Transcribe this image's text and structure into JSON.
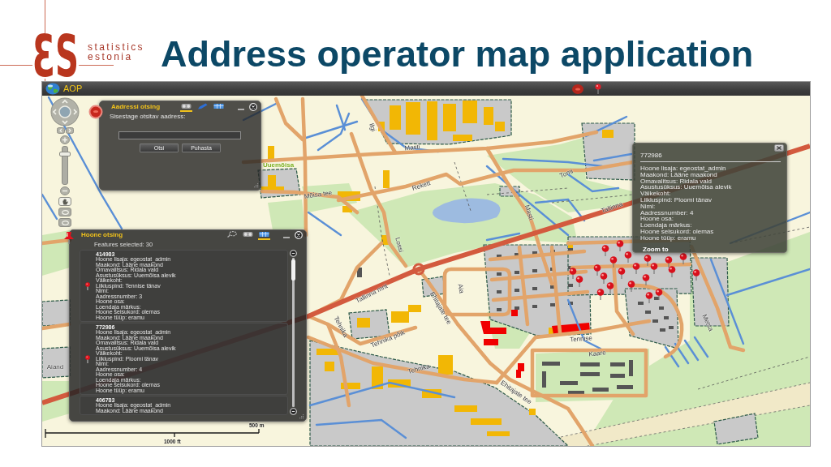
{
  "logo": {
    "mark": "ƐS",
    "name_lines": [
      "statistics",
      "estonia"
    ]
  },
  "title": "Address operator map application",
  "app": {
    "title": "AOP"
  },
  "map": {
    "labels": [
      {
        "text": "Masti",
        "kind": "street"
      },
      {
        "text": "Masti",
        "kind": "street"
      },
      {
        "text": "Ilgi",
        "kind": "street"
      },
      {
        "text": "Uuemõisa",
        "kind": "place"
      },
      {
        "text": "Mõisa tee",
        "kind": "street"
      },
      {
        "text": "Rekett",
        "kind": "street"
      },
      {
        "text": "Tomi",
        "kind": "street"
      },
      {
        "text": "Tallinna",
        "kind": "street"
      },
      {
        "text": "Tallinna mnt",
        "kind": "street"
      },
      {
        "text": "Lossi",
        "kind": "street"
      },
      {
        "text": "Aia",
        "kind": "street"
      },
      {
        "text": "Ehitajate tee",
        "kind": "street"
      },
      {
        "text": "Tehnika",
        "kind": "street"
      },
      {
        "text": "Tehnika põik",
        "kind": "street"
      },
      {
        "text": "Tehnika",
        "kind": "street"
      },
      {
        "text": "Ehitajate tee",
        "kind": "street"
      },
      {
        "text": "Tennise",
        "kind": "street"
      },
      {
        "text": "Kaare",
        "kind": "street"
      },
      {
        "text": "Metsa",
        "kind": "street"
      },
      {
        "text": "Aiand",
        "kind": "street"
      }
    ]
  },
  "navigation": {
    "zoom_slider": {
      "level": 0.85
    },
    "tools": [
      {
        "kind": "hand",
        "selected": true
      },
      {
        "kind": "ellipse",
        "selected": false
      },
      {
        "kind": "ellipse",
        "selected": false
      }
    ]
  },
  "address_search": {
    "title": "Aadressi otsing",
    "tabs": [
      {
        "kind": "binoculars",
        "selected": true
      },
      {
        "kind": "pen",
        "selected": false
      },
      {
        "kind": "table",
        "selected": false
      }
    ],
    "prompt": "Sisestage otsitav aadress:",
    "buttons": [
      "Otsi",
      "Puhasta"
    ]
  },
  "building_search": {
    "title": "Hoone otsing",
    "tabs": [
      {
        "kind": "lasso",
        "selected": false
      },
      {
        "kind": "binoculars",
        "selected": false
      },
      {
        "kind": "table",
        "selected": true
      }
    ],
    "summary": "Features selected: 30",
    "results": [
      {
        "id": "414983",
        "fields": [
          "Hoone lisaja: egeostat_admin",
          "Maakond: Lääne maakond",
          "Omavalitsus: Ridala vald",
          "Asustusüksus: Uuemõisa alevik",
          "Väikekoht:",
          "Liikluspind: Tennise tänav",
          "Nimi:",
          "Aadressnumber: 3",
          "Hoone osa:",
          "Loendaja märkus:",
          "Hoone seisukord: olemas",
          "Hoone tüüp: eramu"
        ]
      },
      {
        "id": "772986",
        "fields": [
          "Hoone lisaja: egeostat_admin",
          "Maakond: Lääne maakond",
          "Omavalitsus: Ridala vald",
          "Asustusüksus: Uuemõisa alevik",
          "Väikekoht:",
          "Liikluspind: Ploomi tänav",
          "Nimi:",
          "Aadressnumber: 4",
          "Hoone osa:",
          "Loendaja märkus:",
          "Hoone seisukord: olemas",
          "Hoone tüüp: eramu"
        ]
      },
      {
        "id": "406783",
        "fields": [
          "Hoone lisaja: egeostat_admin",
          "Maakond: Lääne maakond"
        ]
      }
    ]
  },
  "popup": {
    "id": "772986",
    "fields": [
      "Hoone lisaja: egeostat_admin",
      "Maakond: Lääne maakond",
      "Omavalitsus: Ridala vald",
      "Asustusüksus: Uuemõisa alevik",
      "Väikekoht:",
      "Liikluspind: Ploomi tänav",
      "Nimi:",
      "Aadressnumber: 4",
      "Hoone osa:",
      "Loendaja märkus:",
      "Hoone seisukord: olemas",
      "Hoone tüüp: eramu"
    ],
    "action": "Zoom to"
  },
  "scale_bar": {
    "metric": "500 m",
    "imperial": "1000 ft"
  }
}
